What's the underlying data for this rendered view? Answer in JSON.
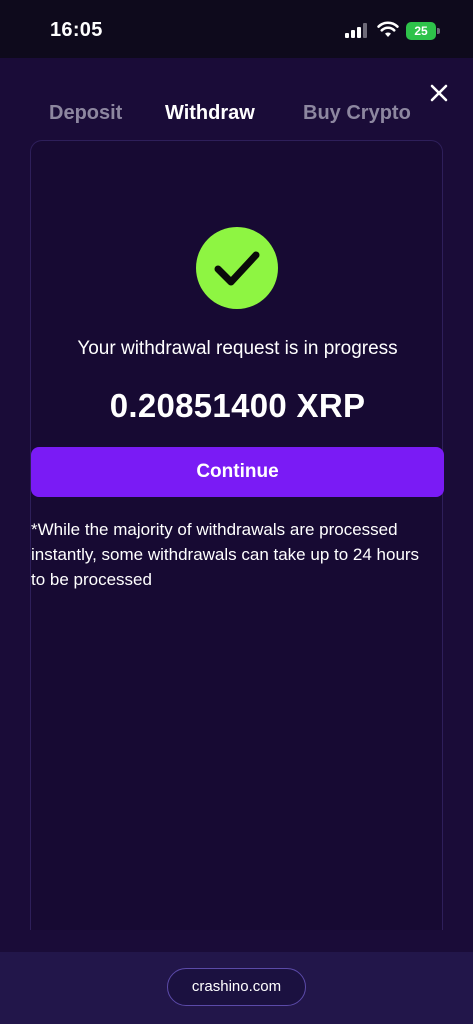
{
  "status_bar": {
    "time": "16:05",
    "battery": "25",
    "battery_color": "#2ec24a"
  },
  "tabs": [
    {
      "label": "Deposit",
      "active": false
    },
    {
      "label": "Withdraw",
      "active": true
    },
    {
      "label": "Buy Crypto",
      "active": false
    }
  ],
  "result": {
    "icon": "check-circle-icon",
    "icon_color": "#8ef542",
    "message": "Your withdrawal request is in progress",
    "amount": "0.20851400 XRP",
    "continue_label": "Continue",
    "button_color": "#7a1bf5",
    "note": "*While the majority of withdrawals are processed instantly, some withdrawals can take up to 24 hours to be processed"
  },
  "footer": {
    "domain": "crashino.com"
  },
  "icons": {
    "close": "close-icon",
    "signal": "cellular-signal-icon",
    "wifi": "wifi-icon",
    "battery": "battery-icon"
  }
}
